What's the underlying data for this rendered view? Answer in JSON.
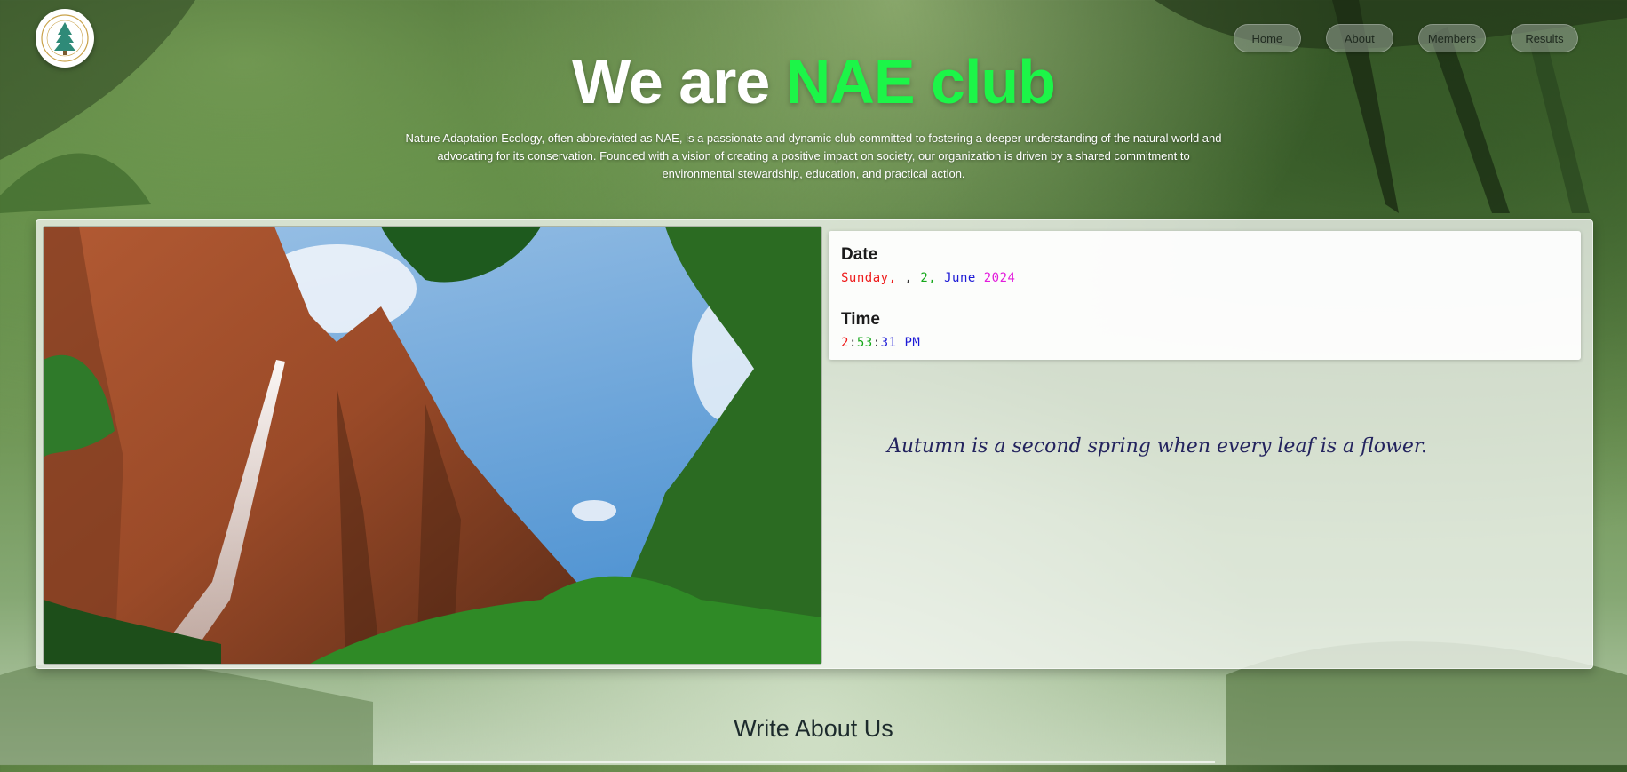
{
  "nav": {
    "items": [
      {
        "label": "Home"
      },
      {
        "label": "About"
      },
      {
        "label": "Members"
      },
      {
        "label": "Results"
      }
    ]
  },
  "hero": {
    "title_prefix": "We are ",
    "title_accent": "NAE club",
    "description": "Nature Adaptation Ecology, often abbreviated as NAE, is a passionate and dynamic club committed to fostering a deeper understanding of the natural world and advocating for its conservation. Founded with a vision of creating a positive impact on society, our organization is driven by a shared commitment to environmental stewardship, education, and practical action."
  },
  "info": {
    "date_label": "Date",
    "date": {
      "weekday": "Sunday,",
      "sep1": " , ",
      "day": "2,",
      "month": " June ",
      "year": "2024"
    },
    "time_label": "Time",
    "time": {
      "hour": "2",
      "colon1": ":",
      "minute": "53",
      "colon2": ":",
      "second": "31",
      "ampm": " PM"
    }
  },
  "quote": "Autumn is a second spring when every leaf is a flower.",
  "write_section": {
    "heading": "Write About Us"
  },
  "colors": {
    "accent_green": "#1cf548",
    "date_red": "#ee1c1c",
    "date_green": "#15a81a",
    "date_blue": "#1d1ad6",
    "date_magenta": "#e31ddc"
  }
}
